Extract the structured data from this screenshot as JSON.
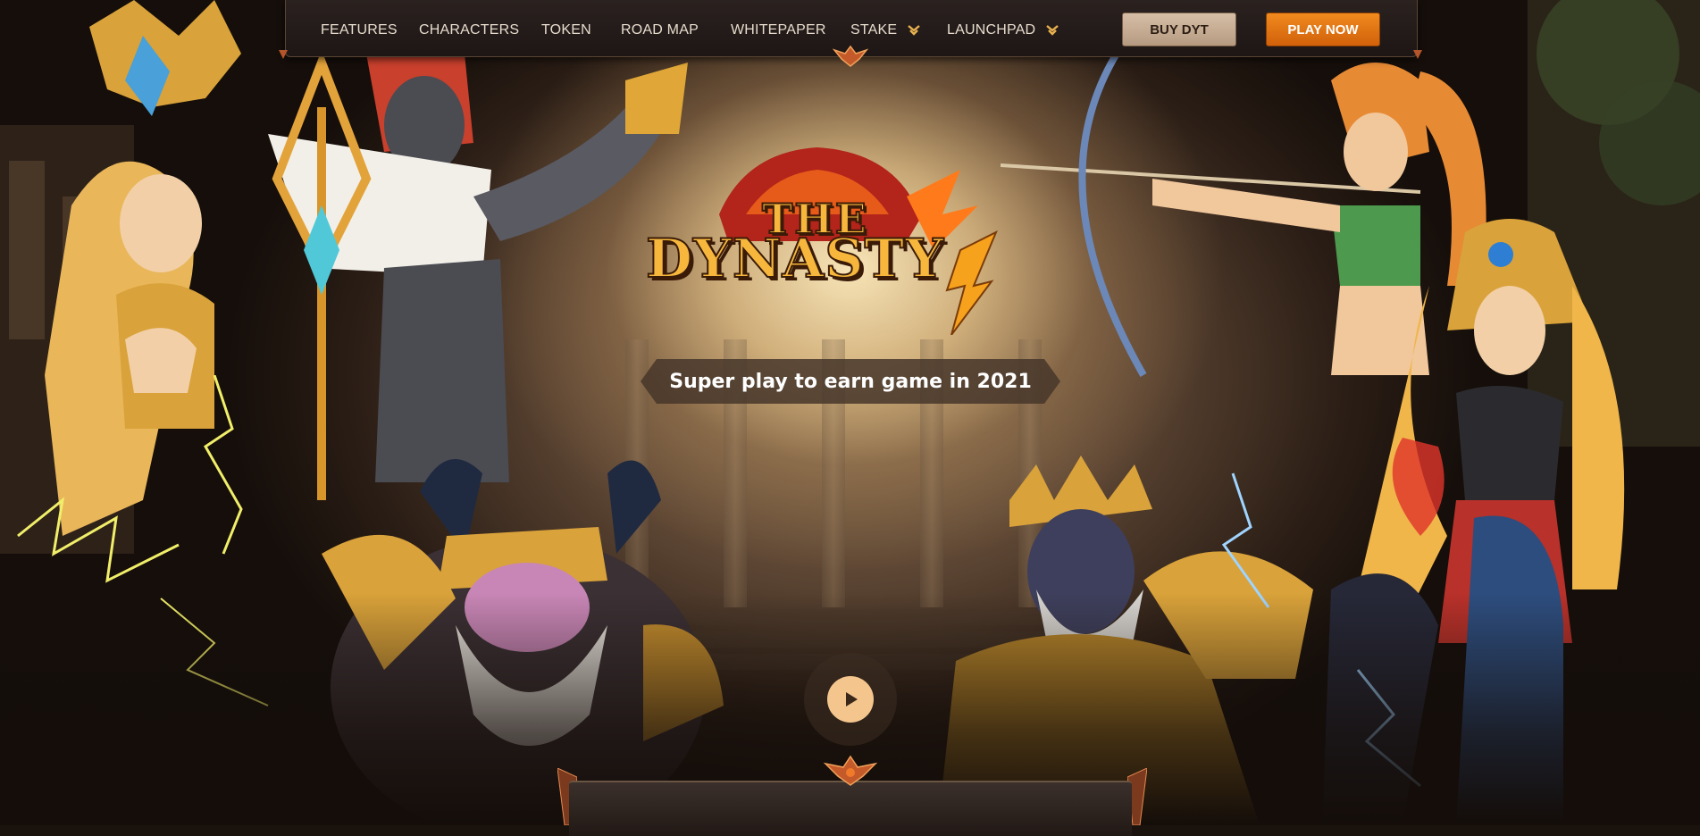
{
  "nav": {
    "items": [
      {
        "label": "FEATURES"
      },
      {
        "label": "CHARACTERS"
      },
      {
        "label": "TOKEN"
      },
      {
        "label": "ROAD MAP"
      },
      {
        "label": "WHITEPAPER"
      },
      {
        "label": "STAKE",
        "has_dropdown": true
      },
      {
        "label": "LAUNCHPAD",
        "has_dropdown": true
      }
    ],
    "buy_label": "BUY DYT",
    "play_label": "PLAY NOW"
  },
  "logo": {
    "line1": "THE",
    "line2": "DYNASTY"
  },
  "hero": {
    "tagline": "Super play to earn game in 2021"
  },
  "colors": {
    "accent": "#e8760f",
    "buy_button": "#c9b096",
    "nav_bg": "#241b18",
    "text_light": "#e7dccd"
  },
  "icons": {
    "play": "play-icon",
    "dropdown": "double-chevron-down-icon"
  }
}
